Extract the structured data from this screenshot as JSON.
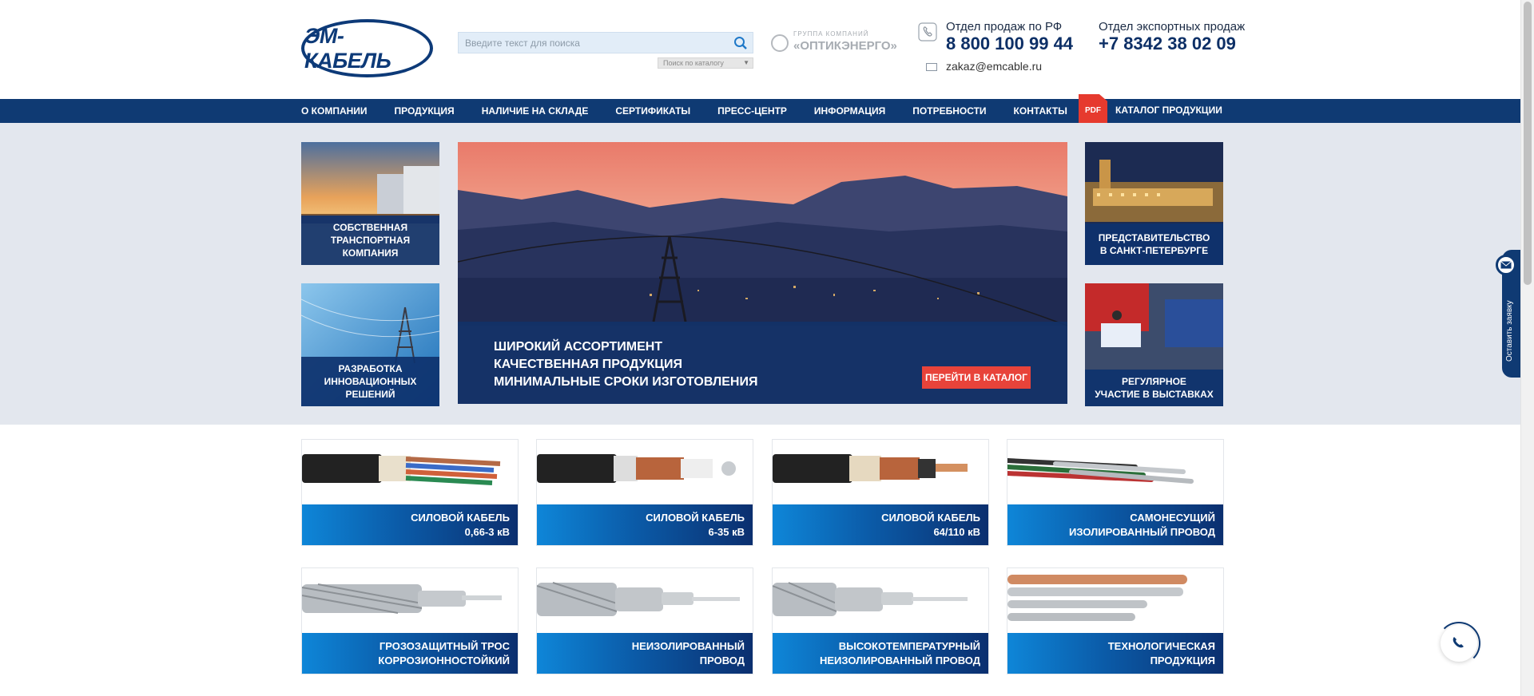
{
  "header": {
    "logo_text": "ЭМ-КАБЕЛЬ",
    "search_placeholder": "Введите текст для поиска",
    "catalog_search": "Поиск по каталогу",
    "group_small": "ГРУППА КОМПАНИЙ",
    "group_name": "«ОПТИКЭНЕРГО»",
    "sales_rf_label": "Отдел продаж по РФ",
    "sales_rf_phone": "8 800 100 99 44",
    "export_label": "Отдел экспортных продаж",
    "export_phone": "+7 8342 38 02 09",
    "email": "zakaz@emcable.ru"
  },
  "nav": {
    "items": [
      "О КОМПАНИИ",
      "ПРОДУКЦИЯ",
      "НАЛИЧИЕ НА СКЛАДЕ",
      "СЕРТИФИКАТЫ",
      "ПРЕСС-ЦЕНТР",
      "ИНФОРМАЦИЯ",
      "ПОТРЕБНОСТИ",
      "КОНТАКТЫ"
    ],
    "pdf_label": "PDF",
    "catalog_label": "КАТАЛОГ ПРОДУКЦИИ"
  },
  "tiles": {
    "transport": [
      "СОБСТВЕННАЯ",
      "ТРАНСПОРТНАЯ",
      "КОМПАНИЯ"
    ],
    "innovation": [
      "РАЗРАБОТКА",
      "ИННОВАЦИОННЫХ",
      "РЕШЕНИЙ"
    ],
    "spb": [
      "ПРЕДСТАВИТЕЛЬСТВО",
      "В САНКТ-ПЕТЕРБУРГЕ"
    ],
    "exhibitions": [
      "РЕГУЛЯРНОЕ",
      "УЧАСТИЕ В ВЫСТАВКАХ"
    ]
  },
  "slider": {
    "lines": [
      "ШИРОКИЙ АССОРТИМЕНТ",
      "КАЧЕСТВЕННАЯ ПРОДУКЦИЯ",
      "МИНИМАЛЬНЫЕ СРОКИ ИЗГОТОВЛЕНИЯ"
    ],
    "button": "ПЕРЕЙТИ В КАТАЛОГ"
  },
  "products": [
    {
      "l1": "СИЛОВОЙ КАБЕЛЬ",
      "l2": "0,66-3 кВ"
    },
    {
      "l1": "СИЛОВОЙ КАБЕЛЬ",
      "l2": "6-35 кВ"
    },
    {
      "l1": "СИЛОВОЙ КАБЕЛЬ",
      "l2": "64/110 кВ"
    },
    {
      "l1": "САМОНЕСУЩИЙ",
      "l2": "ИЗОЛИРОВАННЫЙ ПРОВОД"
    },
    {
      "l1": "ГРОЗОЗАЩИТНЫЙ ТРОС",
      "l2": "КОРРОЗИОННОСТОЙКИЙ"
    },
    {
      "l1": "НЕИЗОЛИРОВАННЫЙ",
      "l2": "ПРОВОД"
    },
    {
      "l1": "ВЫСОКОТЕМПЕРАТУРНЫЙ",
      "l2": "НЕИЗОЛИРОВАННЫЙ ПРОВОД"
    },
    {
      "l1": "ТЕХНОЛОГИЧЕСКАЯ",
      "l2": "ПРОДУКЦИЯ"
    }
  ],
  "widgets": {
    "request_tab": "Оставить заявку"
  },
  "colors": {
    "brand_blue": "#0f3a73",
    "accent_red": "#e8433a"
  }
}
